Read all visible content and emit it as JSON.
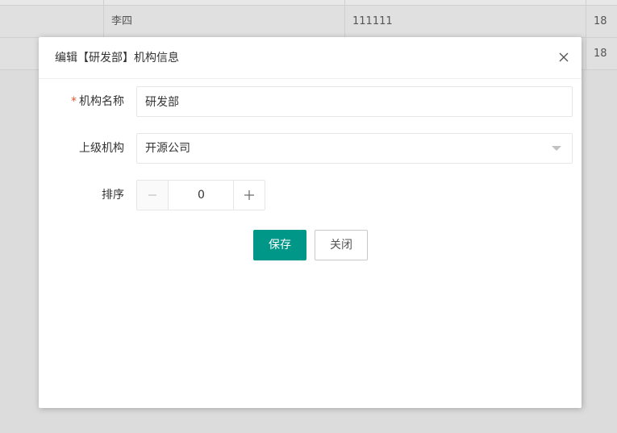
{
  "table": {
    "rows": [
      {
        "c0": "",
        "c1": "",
        "c2": "",
        "c3": ""
      },
      {
        "c0": "",
        "c1": "李四",
        "c2": "111111",
        "c3": "18"
      },
      {
        "c0": "",
        "c1": "",
        "c2": "",
        "c3": "18"
      }
    ]
  },
  "dialog": {
    "title": "编辑【研发部】机构信息",
    "close_icon": "close-icon"
  },
  "form": {
    "name": {
      "required_mark": "*",
      "label": "机构名称",
      "value": "研发部"
    },
    "parent": {
      "label": "上级机构",
      "value": "开源公司"
    },
    "order": {
      "label": "排序",
      "value": "0"
    }
  },
  "buttons": {
    "save": "保存",
    "close": "关闭"
  },
  "colors": {
    "primary": "#009688",
    "required": "#e4582f"
  }
}
